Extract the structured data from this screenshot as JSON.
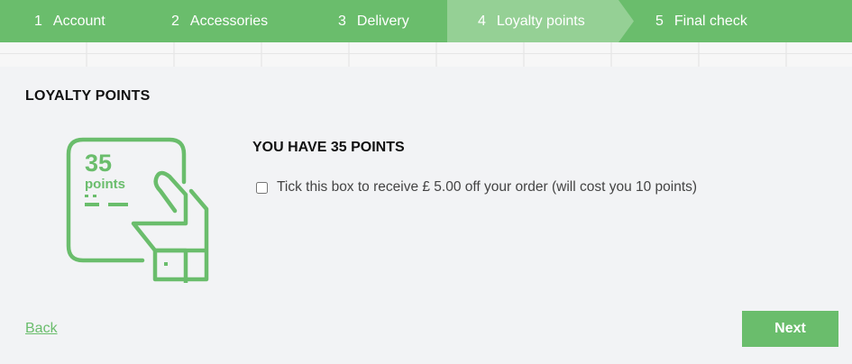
{
  "stepper": {
    "steps": [
      {
        "number": "1",
        "label": "Account"
      },
      {
        "number": "2",
        "label": "Accessories"
      },
      {
        "number": "3",
        "label": "Delivery"
      },
      {
        "number": "4",
        "label": "Loyalty points"
      },
      {
        "number": "5",
        "label": "Final check"
      }
    ],
    "active_step": 4
  },
  "loyalty": {
    "title": "LOYALTY POINTS",
    "card": {
      "points_value": "35",
      "points_word": "points"
    },
    "heading": "YOU HAVE 35 POINTS",
    "option": {
      "label": "Tick this box to receive £ 5.00 off your order (will cost you 10 points)",
      "checked": false
    }
  },
  "actions": {
    "back_label": "Back",
    "next_label": "Next"
  },
  "colors": {
    "brand_green": "#6abd6c",
    "active_step_green": "#95d095",
    "panel_background": "#f2f3f5"
  }
}
